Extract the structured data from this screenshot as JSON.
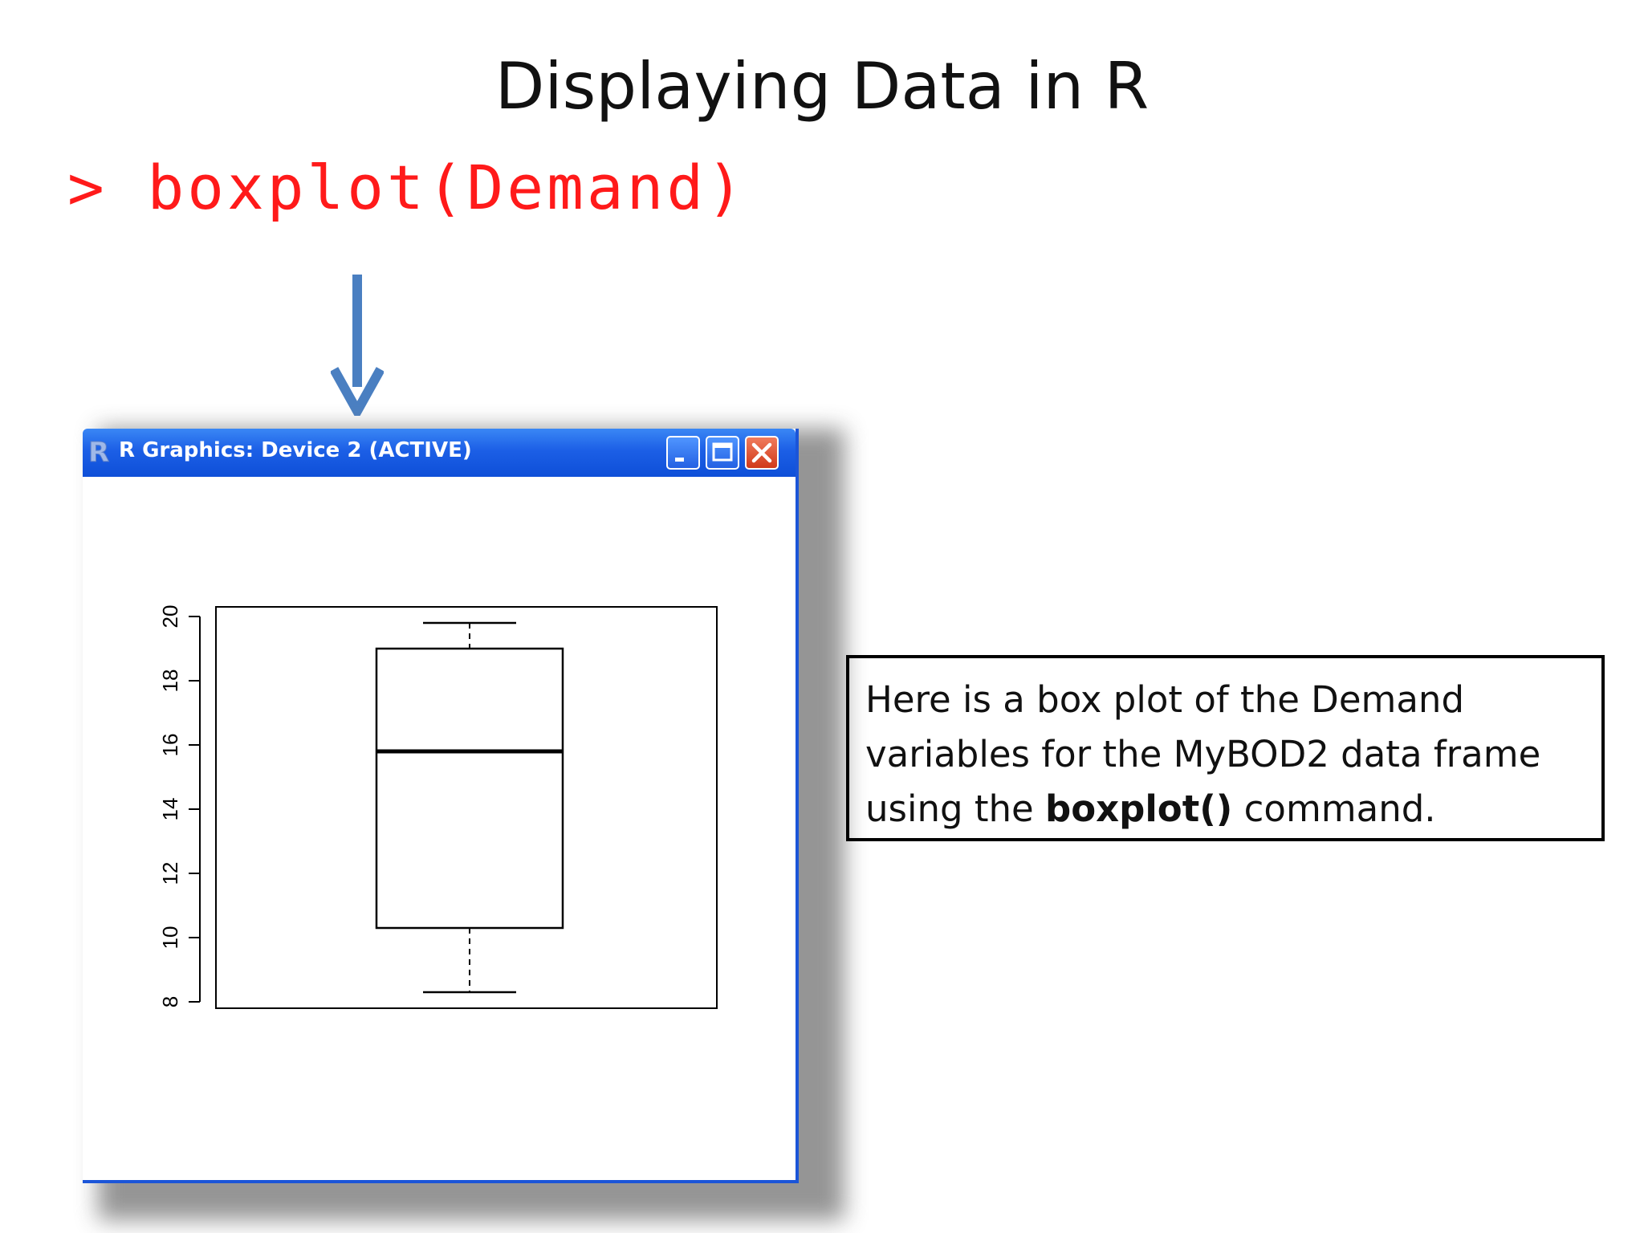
{
  "slide": {
    "title": "Displaying Data in R",
    "command": "> boxplot(Demand)"
  },
  "window": {
    "title": "R Graphics: Device 2 (ACTIVE)",
    "titlebar_color": "#1c5fe6",
    "border_color": "#1b55d8"
  },
  "description": {
    "line1": "Here is a box plot of the Demand",
    "line2": "variables for the MyBOD2 data frame",
    "line3_prefix": "using the ",
    "line3_bold": "boxplot()",
    "line3_suffix": " command."
  },
  "colors": {
    "command": "#ff1a1a",
    "arrow": "#4a7fc1"
  },
  "chart_data": {
    "type": "box",
    "title": "",
    "xlabel": "",
    "ylabel": "",
    "ylim": [
      7.8,
      20.3
    ],
    "yticks": [
      8,
      10,
      12,
      14,
      16,
      18,
      20
    ],
    "ytick_labels": [
      "8",
      "10",
      "12",
      "14",
      "16",
      "18",
      "20"
    ],
    "box": {
      "min": 8.3,
      "q1": 10.3,
      "median": 15.8,
      "q3": 19.0,
      "max": 19.8
    }
  }
}
